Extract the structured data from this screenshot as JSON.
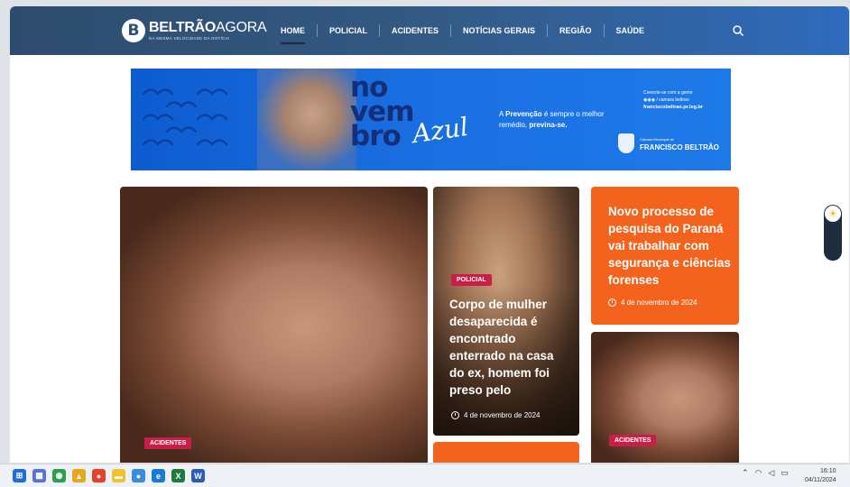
{
  "site": {
    "logo_brand": "BELTRÃO",
    "logo_suffix": "AGORA",
    "logo_tagline": "NA MESMA VELOCIDADE DA NOTÍCIA"
  },
  "nav": {
    "items": [
      {
        "label": "HOME"
      },
      {
        "label": "POLICIAL"
      },
      {
        "label": "ACIDENTES"
      },
      {
        "label": "NOTÍCIAS GERAIS"
      },
      {
        "label": "REGIÃO"
      },
      {
        "label": "SAÚDE"
      }
    ],
    "active": "HOME"
  },
  "banner": {
    "line1": "no",
    "line2": "vem",
    "line3": "bro",
    "azul": "Azul",
    "prevention_pre": "A ",
    "prevention_bold": "Prevenção",
    "prevention_mid": " é sempre o melhor remédio, ",
    "prevention_end": "previna-se.",
    "connect": "Conecte-se com a gente",
    "social": "/ camara beltrao",
    "site": "franciscobeltrao.pr.leg.br",
    "camara_small": "Câmara Municipal de",
    "camara_big": "FRANCISCO BELTRÃO"
  },
  "cards": {
    "big": {
      "badge": "ACIDENTES"
    },
    "mid": {
      "badge": "POLICIAL",
      "headline": "Corpo de mulher desaparecida é encontrado enterrado na casa do ex, homem foi preso pelo",
      "date": "4 de novembro de 2024"
    },
    "orange": {
      "headline": "Novo processo de pesquisa do Paraná vai trabalhar com segurança e ciências forenses",
      "date": "4 de novembro de 2024"
    },
    "small": {
      "badge": "ACIDENTES"
    }
  },
  "taskbar": {
    "time": "16:10",
    "date": "04/11/2024"
  },
  "colors": {
    "nav_start": "#2d4c6d",
    "nav_end": "#2f6bbd",
    "accent_orange": "#f4631d",
    "badge_red": "#c81f4a"
  }
}
